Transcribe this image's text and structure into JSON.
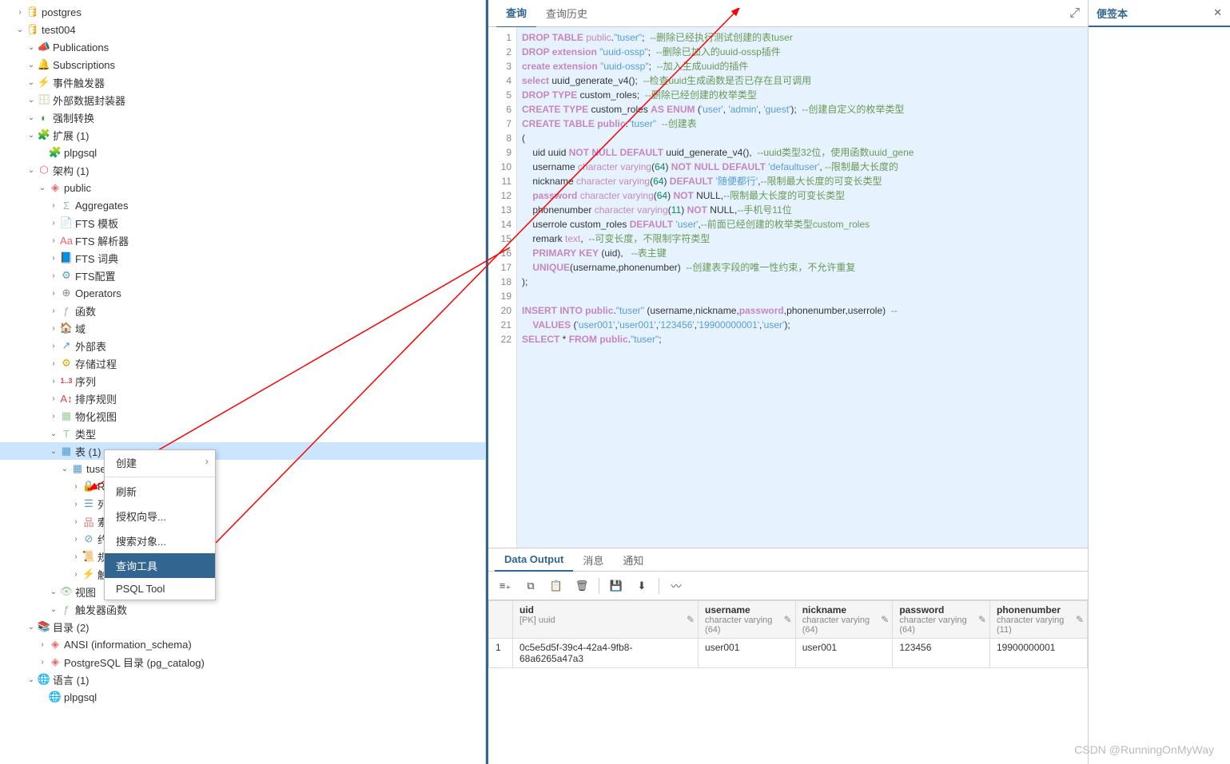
{
  "sidebar": {
    "items": [
      {
        "label": "postgres",
        "indent": 1,
        "arrow": ">",
        "iconClass": "icon-db",
        "iconName": "database-icon",
        "glyph": "🛢"
      },
      {
        "label": "test004",
        "indent": 1,
        "arrow": "v",
        "iconClass": "icon-db",
        "iconName": "database-icon",
        "glyph": "🛢"
      },
      {
        "label": "Publications",
        "indent": 2,
        "arrow": "v",
        "iconClass": "icon-pub",
        "iconName": "publications-icon",
        "glyph": "📣"
      },
      {
        "label": "Subscriptions",
        "indent": 2,
        "arrow": "v",
        "iconClass": "icon-sub",
        "iconName": "subscriptions-icon",
        "glyph": "🔔"
      },
      {
        "label": "事件触发器",
        "indent": 2,
        "arrow": "v",
        "iconClass": "icon-trig",
        "iconName": "event-trigger-icon",
        "glyph": "⚡"
      },
      {
        "label": "外部数据封装器",
        "indent": 2,
        "arrow": "v",
        "iconClass": "icon-fdw",
        "iconName": "fdw-icon",
        "glyph": "🗄"
      },
      {
        "label": "强制转换",
        "indent": 2,
        "arrow": "v",
        "iconClass": "icon-cast",
        "iconName": "cast-icon",
        "glyph": "◐"
      },
      {
        "label": "扩展 (1)",
        "indent": 2,
        "arrow": "v",
        "iconClass": "icon-ext",
        "iconName": "extension-icon",
        "glyph": "🧩"
      },
      {
        "label": "plpgsql",
        "indent": 3,
        "arrow": "",
        "iconClass": "icon-ext",
        "iconName": "extension-item-icon",
        "glyph": "🧩"
      },
      {
        "label": "架构 (1)",
        "indent": 2,
        "arrow": "v",
        "iconClass": "icon-schema",
        "iconName": "schema-icon",
        "glyph": "⬡"
      },
      {
        "label": "public",
        "indent": 3,
        "arrow": "v",
        "iconClass": "icon-diamond",
        "iconName": "schema-item-icon",
        "glyph": "◈"
      },
      {
        "label": "Aggregates",
        "indent": 4,
        "arrow": ">",
        "iconClass": "icon-func",
        "iconName": "aggregates-icon",
        "glyph": "Σ"
      },
      {
        "label": "FTS 模板",
        "indent": 4,
        "arrow": ">",
        "iconClass": "icon-text",
        "iconName": "fts-template-icon",
        "glyph": "📄"
      },
      {
        "label": "FTS 解析器",
        "indent": 4,
        "arrow": ">",
        "iconClass": "icon-text",
        "iconName": "fts-parser-icon",
        "glyph": "Aa"
      },
      {
        "label": "FTS 词典",
        "indent": 4,
        "arrow": ">",
        "iconClass": "icon-dict",
        "iconName": "fts-dict-icon",
        "glyph": "📘"
      },
      {
        "label": "FTS配置",
        "indent": 4,
        "arrow": ">",
        "iconClass": "icon-dict",
        "iconName": "fts-config-icon",
        "glyph": "⚙"
      },
      {
        "label": "Operators",
        "indent": 4,
        "arrow": ">",
        "iconClass": "icon-op",
        "iconName": "operators-icon",
        "glyph": "⊕"
      },
      {
        "label": "函数",
        "indent": 4,
        "arrow": ">",
        "iconClass": "icon-func",
        "iconName": "functions-icon",
        "glyph": "ƒ"
      },
      {
        "label": "域",
        "indent": 4,
        "arrow": ">",
        "iconClass": "icon-domain",
        "iconName": "domains-icon",
        "glyph": "🏠"
      },
      {
        "label": "外部表",
        "indent": 4,
        "arrow": ">",
        "iconClass": "icon-fk",
        "iconName": "foreign-tables-icon",
        "glyph": "↗"
      },
      {
        "label": "存储过程",
        "indent": 4,
        "arrow": ">",
        "iconClass": "icon-proc",
        "iconName": "procedures-icon",
        "glyph": "⚙"
      },
      {
        "label": "序列",
        "indent": 4,
        "arrow": ">",
        "iconClass": "icon-seq",
        "iconName": "sequences-icon",
        "glyph": "1..3"
      },
      {
        "label": "排序规则",
        "indent": 4,
        "arrow": ">",
        "iconClass": "icon-coll",
        "iconName": "collations-icon",
        "glyph": "A↕"
      },
      {
        "label": "物化视图",
        "indent": 4,
        "arrow": ">",
        "iconClass": "icon-mv",
        "iconName": "mat-views-icon",
        "glyph": "▦"
      },
      {
        "label": "类型",
        "indent": 4,
        "arrow": "v",
        "iconClass": "icon-type",
        "iconName": "types-icon",
        "glyph": "T"
      },
      {
        "label": "表 (1)",
        "indent": 4,
        "arrow": "v",
        "iconClass": "icon-table",
        "iconName": "tables-icon",
        "glyph": "▦",
        "selected": true
      },
      {
        "label": "tuser",
        "indent": 5,
        "arrow": "v",
        "iconClass": "icon-table",
        "iconName": "table-icon",
        "glyph": "▦"
      },
      {
        "label": "RLS",
        "indent": 6,
        "arrow": ">",
        "iconClass": "icon-rls",
        "iconName": "rls-icon",
        "glyph": "🔒",
        "trunc": true
      },
      {
        "label": "列",
        "indent": 6,
        "arrow": ">",
        "iconClass": "icon-col",
        "iconName": "columns-icon",
        "glyph": "☰"
      },
      {
        "label": "索引",
        "indent": 6,
        "arrow": ">",
        "iconClass": "icon-idx",
        "iconName": "indexes-icon",
        "glyph": "品"
      },
      {
        "label": "约束",
        "indent": 6,
        "arrow": ">",
        "iconClass": "icon-cons",
        "iconName": "constraints-icon",
        "glyph": "⊘"
      },
      {
        "label": "规则",
        "indent": 6,
        "arrow": ">",
        "iconClass": "icon-rule",
        "iconName": "rules-icon",
        "glyph": "📜"
      },
      {
        "label": "触发",
        "indent": 6,
        "arrow": ">",
        "iconClass": "icon-trig",
        "iconName": "triggers-icon",
        "glyph": "⚡"
      },
      {
        "label": "视图",
        "indent": 4,
        "arrow": "v",
        "iconClass": "icon-view",
        "iconName": "views-icon",
        "glyph": "👁"
      },
      {
        "label": "触发器函数",
        "indent": 4,
        "arrow": "v",
        "iconClass": "icon-func",
        "iconName": "trigger-funcs-icon",
        "glyph": "ƒ"
      },
      {
        "label": "目录 (2)",
        "indent": 2,
        "arrow": "v",
        "iconClass": "icon-cat",
        "iconName": "catalogs-icon",
        "glyph": "📚"
      },
      {
        "label": "ANSI (information_schema)",
        "indent": 3,
        "arrow": ">",
        "iconClass": "icon-diamond",
        "iconName": "catalog-item-icon",
        "glyph": "◈"
      },
      {
        "label": "PostgreSQL 目录 (pg_catalog)",
        "indent": 3,
        "arrow": ">",
        "iconClass": "icon-diamond",
        "iconName": "catalog-item-icon",
        "glyph": "◈"
      },
      {
        "label": "语言 (1)",
        "indent": 2,
        "arrow": "v",
        "iconClass": "icon-lang",
        "iconName": "languages-icon",
        "glyph": "🌐"
      },
      {
        "label": "plpgsql",
        "indent": 3,
        "arrow": "",
        "iconClass": "icon-lang",
        "iconName": "language-item-icon",
        "glyph": "🌐"
      }
    ]
  },
  "context_menu": {
    "items": [
      {
        "label": "创建",
        "arrow": true
      },
      {
        "sep": true
      },
      {
        "label": "刷新"
      },
      {
        "label": "授权向导..."
      },
      {
        "label": "搜索对象..."
      },
      {
        "label": "查询工具",
        "highlight": true
      },
      {
        "label": "PSQL Tool"
      }
    ]
  },
  "tabs": {
    "query": "查询",
    "history": "查询历史"
  },
  "sticky": {
    "title": "便签本"
  },
  "code_lines": [
    {
      "n": 1,
      "html": "<span class='kw'>DROP TABLE</span> <span class='kw2'>public</span>.<span class='str'>\"tuser\"</span>;  <span class='cmt'>--删除已经执行测试创建的表tuser</span>"
    },
    {
      "n": 2,
      "html": "<span class='kw'>DROP extension</span> <span class='str'>\"uuid-ossp\"</span>;  <span class='cmt'>--删除已加入的uuid-ossp插件</span>"
    },
    {
      "n": 3,
      "html": "<span class='kw'>create extension</span> <span class='str'>\"uuid-ossp\"</span>;  <span class='cmt'>--加入生成uuid的插件</span>"
    },
    {
      "n": 4,
      "html": "<span class='kw'>select</span> uuid_generate_v4();  <span class='cmt'>--检查uuid生成函数是否已存在且可调用</span>"
    },
    {
      "n": 5,
      "html": "<span class='kw'>DROP TYPE</span> custom_roles;  <span class='cmt'>--删除已经创建的枚举类型</span>"
    },
    {
      "n": 6,
      "html": "<span class='kw'>CREATE TYPE</span> custom_roles <span class='kw'>AS ENUM</span> (<span class='str'>'user'</span>, <span class='str'>'admin'</span>, <span class='str'>'guest'</span>);  <span class='cmt'>--创建自定义的枚举类型</span>"
    },
    {
      "n": 7,
      "html": "<span class='kw'>CREATE TABLE public</span>.<span class='str'>\"tuser\"</span>  <span class='cmt'>--创建表</span>"
    },
    {
      "n": 8,
      "html": "("
    },
    {
      "n": 9,
      "html": "    uid uuid <span class='kw'>NOT NULL DEFAULT</span> uuid_generate_v4(),  <span class='cmt'>--uuid类型32位，使用函数uuid_gene</span>"
    },
    {
      "n": 10,
      "html": "    username <span class='kw2'>character varying</span>(<span class='num'>64</span>) <span class='kw'>NOT NULL DEFAULT</span> <span class='str'>'defaultuser'</span>, <span class='cmt'>--限制最大长度的</span>"
    },
    {
      "n": 11,
      "html": "    nickname <span class='kw2'>character varying</span>(<span class='num'>64</span>) <span class='kw'>DEFAULT</span> <span class='str'>'随便都行'</span>,<span class='cmt'>--限制最大长度的可变长类型</span>"
    },
    {
      "n": 12,
      "html": "    <span class='kw'>password</span> <span class='kw2'>character varying</span>(<span class='num'>64</span>) <span class='kw'>NOT</span> NULL,<span class='cmt'>--限制最大长度的可变长类型</span>"
    },
    {
      "n": 13,
      "html": "    phonenumber <span class='kw2'>character varying</span>(<span class='num'>11</span>) <span class='kw'>NOT</span> NULL,<span class='cmt'>--手机号11位</span>"
    },
    {
      "n": 14,
      "html": "    userrole custom_roles <span class='kw'>DEFAULT</span> <span class='str'>'user'</span>,<span class='cmt'>--前面已经创建的枚举类型custom_roles</span>"
    },
    {
      "n": 15,
      "html": "    remark <span class='kw2'>text</span>,  <span class='cmt'>--可变长度，不限制字符类型</span>"
    },
    {
      "n": 16,
      "html": "    <span class='kw'>PRIMARY KEY</span> (uid),   <span class='cmt'>--表主键</span>"
    },
    {
      "n": 17,
      "html": "    <span class='kw'>UNIQUE</span>(username,phonenumber)  <span class='cmt'>--创建表字段的唯一性约束，不允许重复</span>"
    },
    {
      "n": 18,
      "html": ");"
    },
    {
      "n": 19,
      "html": ""
    },
    {
      "n": 20,
      "html": "<span class='kw'>INSERT INTO public</span>.<span class='str'>\"tuser\"</span> (username,nickname,<span class='kw'>password</span>,phonenumber,userrole)  <span class='cmt'>--</span>"
    },
    {
      "n": 21,
      "html": "    <span class='kw'>VALUES</span> (<span class='str'>'user001'</span>,<span class='str'>'user001'</span>,<span class='str'>'123456'</span>,<span class='str'>'19900000001'</span>,<span class='str'>'user'</span>);"
    },
    {
      "n": 22,
      "html": "<span class='kw'>SELECT</span> * <span class='kw'>FROM public</span>.<span class='str'>\"tuser\"</span>;"
    }
  ],
  "bottom_tabs": {
    "data": "Data Output",
    "msg": "消息",
    "notify": "通知"
  },
  "data_columns": [
    {
      "name": "uid",
      "type": "[PK] uuid"
    },
    {
      "name": "username",
      "type": "character varying (64)"
    },
    {
      "name": "nickname",
      "type": "character varying (64)"
    },
    {
      "name": "password",
      "type": "character varying (64)"
    },
    {
      "name": "phonenumber",
      "type": "character varying (11)"
    }
  ],
  "data_rows": [
    {
      "n": "1",
      "cells": [
        "0c5e5d5f-39c4-42a4-9fb8-68a6265a47a3",
        "user001",
        "user001",
        "123456",
        "19900000001"
      ]
    }
  ],
  "watermark": "CSDN @RunningOnMyWay"
}
